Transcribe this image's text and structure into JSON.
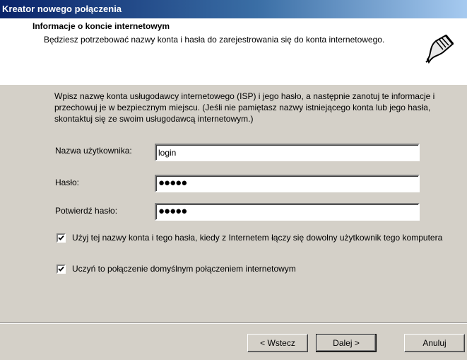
{
  "window": {
    "title": "Kreator nowego połączenia"
  },
  "header": {
    "title": "Informacje o koncie internetowym",
    "subtitle": "Będziesz potrzebować nazwy konta i hasła do zarejestrowania się do konta internetowego.",
    "icon": "network-cable-icon"
  },
  "intro": "Wpisz nazwę konta usługodawcy internetowego (ISP) i jego hasło, a następnie zanotuj te informacje i przechowuj je w bezpiecznym miejscu. (Jeśli nie pamiętasz nazwy istniejącego konta lub jego hasła, skontaktuj się ze swoim usługodawcą internetowym.)",
  "fields": {
    "username": {
      "label": "Nazwa użytkownika:",
      "value": "login"
    },
    "password": {
      "label": "Hasło:",
      "value": "●●●●●"
    },
    "confirm": {
      "label": "Potwierdź hasło:",
      "value": "●●●●●"
    }
  },
  "options": {
    "any_user": {
      "label": "Użyj tej nazwy konta i tego hasła, kiedy z Internetem łączy się dowolny użytkownik tego komputera",
      "checked": true
    },
    "default_conn": {
      "label": "Uczyń to połączenie domyślnym połączeniem internetowym",
      "checked": true
    }
  },
  "buttons": {
    "back": "< Wstecz",
    "next": "Dalej >",
    "cancel": "Anuluj"
  },
  "colors": {
    "titlebar_start": "#0a246a",
    "titlebar_end": "#a6caf0",
    "face": "#d4d0c8"
  }
}
